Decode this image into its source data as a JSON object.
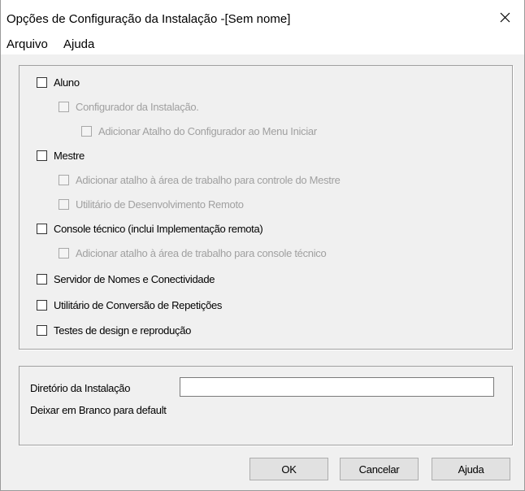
{
  "window": {
    "title": "Opções de Configuração da Instalação -[Sem nome]"
  },
  "menu": {
    "items": [
      "Arquivo",
      "Ajuda"
    ]
  },
  "options": [
    {
      "label": "Aluno",
      "checked": false,
      "enabled": true
    },
    {
      "label": "Configurador da Instalação.",
      "checked": false,
      "enabled": false
    },
    {
      "label": "Adicionar Atalho do Configurador ao Menu Iniciar",
      "checked": false,
      "enabled": false
    },
    {
      "label": "Mestre",
      "checked": false,
      "enabled": true
    },
    {
      "label": "Adicionar atalho à área de trabalho para controle do Mestre",
      "checked": false,
      "enabled": false
    },
    {
      "label": "Utilitário de Desenvolvimento Remoto",
      "checked": false,
      "enabled": false
    },
    {
      "label": "Console técnico (inclui Implementação remota)",
      "checked": false,
      "enabled": true
    },
    {
      "label": "Adicionar atalho à área de trabalho para console técnico",
      "checked": false,
      "enabled": false
    },
    {
      "label": "Servidor de Nomes e Conectividade",
      "checked": false,
      "enabled": true
    },
    {
      "label": "Utilitário de Conversão de Repetições",
      "checked": false,
      "enabled": true
    },
    {
      "label": "Testes de design e reprodução",
      "checked": false,
      "enabled": true
    }
  ],
  "install_dir": {
    "label": "Diretório da Instalação",
    "value": "",
    "hint": "Deixar em Branco para default"
  },
  "buttons": {
    "ok": "OK",
    "cancel": "Cancelar",
    "help": "Ajuda"
  },
  "icons": {
    "close": "close-icon"
  }
}
